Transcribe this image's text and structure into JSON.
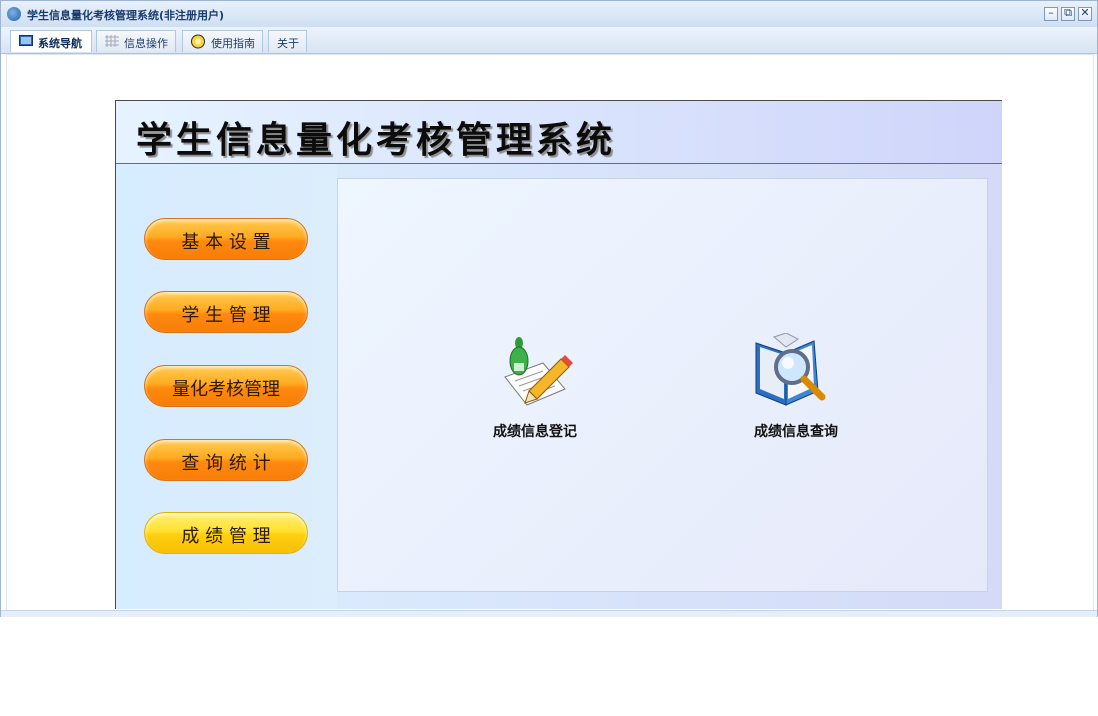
{
  "window": {
    "title": "学生信息量化考核管理系统(非注册用户)",
    "controls": {
      "minimize": "–",
      "restore": "⧉",
      "close": "✕"
    }
  },
  "tabs": [
    {
      "label": "系统导航",
      "icon": "monitor-icon",
      "active": true
    },
    {
      "label": "信息操作",
      "icon": "grid-icon",
      "active": false
    },
    {
      "label": "使用指南",
      "icon": "guide-icon",
      "active": false
    },
    {
      "label": "关于",
      "icon": "",
      "active": false
    }
  ],
  "panel": {
    "title": "学生信息量化考核管理系统"
  },
  "sidebar": {
    "items": [
      {
        "label": "基 本 设 置",
        "color": "orange"
      },
      {
        "label": "学 生 管 理",
        "color": "orange"
      },
      {
        "label": "量化考核管理",
        "color": "orange"
      },
      {
        "label": "查 询 统 计",
        "color": "orange"
      },
      {
        "label": "成 绩 管 理",
        "color": "yellow"
      }
    ]
  },
  "features": [
    {
      "label": "成绩信息登记",
      "icon": "register-icon"
    },
    {
      "label": "成绩信息查询",
      "icon": "search-book-icon"
    }
  ]
}
